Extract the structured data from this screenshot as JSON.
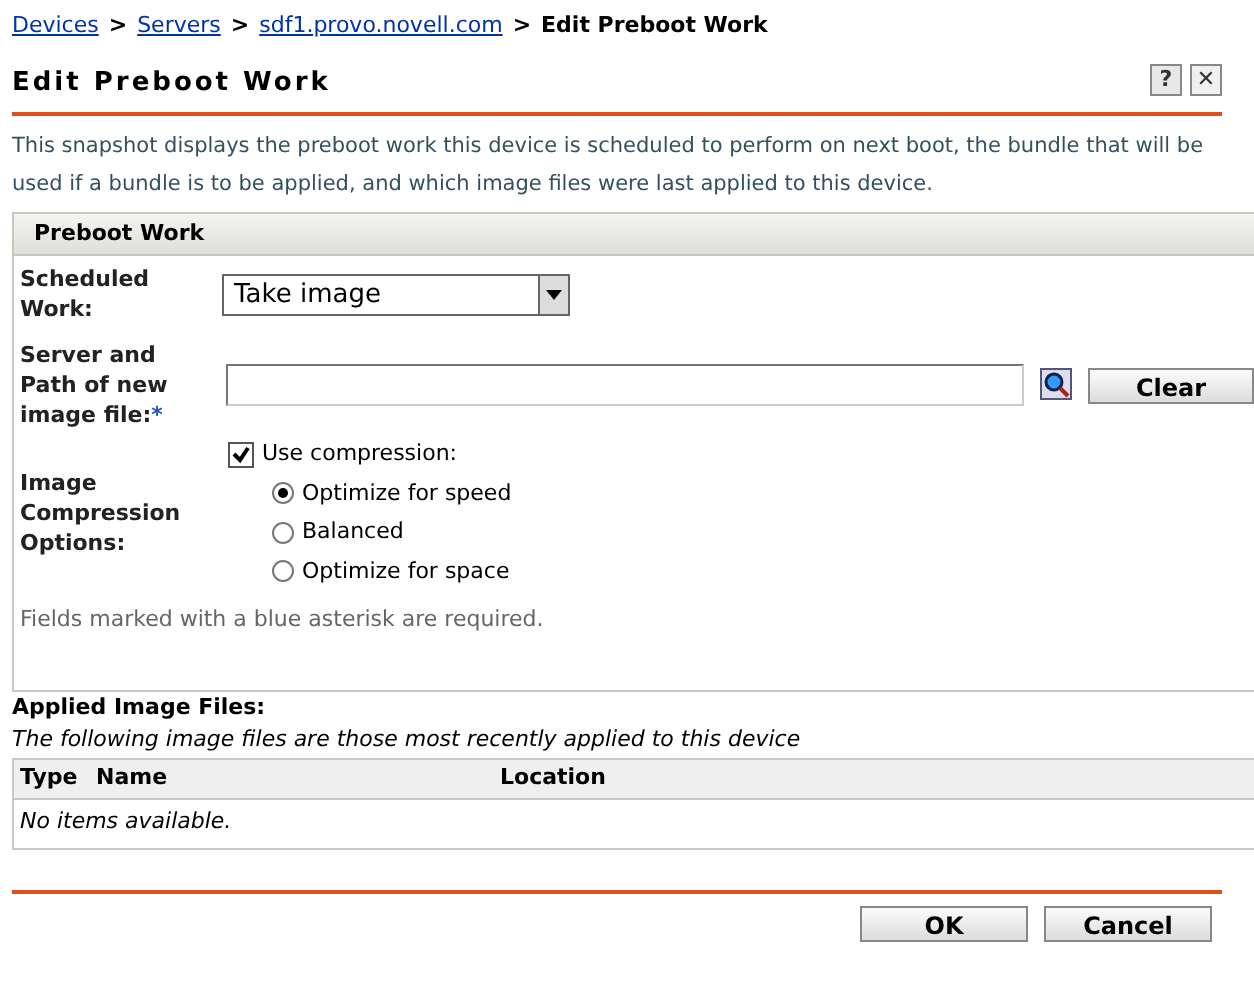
{
  "breadcrumb": [
    {
      "label": "Devices",
      "kind": "link"
    },
    {
      "label": "Servers",
      "kind": "link"
    },
    {
      "label": "sdf1.provo.novell.com",
      "kind": "link"
    },
    {
      "label": "Edit Preboot Work",
      "kind": "current"
    }
  ],
  "breadcrumb_separator": ">",
  "title": "Edit Preboot Work",
  "title_buttons": [
    {
      "label": "?",
      "kind": "help"
    },
    {
      "label": "✕",
      "kind": "close"
    }
  ],
  "description": "This snapshot displays the preboot work this device is scheduled to perform on next boot, the bundle that will be used if a bundle is to be applied, and which image files were last applied to this device.",
  "panel": {
    "title": "Preboot Work",
    "scheduled_work": {
      "label": "Scheduled Work:",
      "value": "Take image"
    },
    "image_path": {
      "label": "Server and Path of new image file:",
      "required_mark": "*",
      "clear_button": "Clear"
    },
    "compression": {
      "label": "Image Compression Options:",
      "checkbox": {
        "label": "Use compression:",
        "checked": true
      },
      "options": [
        {
          "label": "Optimize for speed",
          "selected": true
        },
        {
          "label": "Balanced",
          "selected": false
        },
        {
          "label": "Optimize for space",
          "selected": false
        }
      ]
    },
    "note": "Fields marked with a blue asterisk are required."
  },
  "applied": {
    "title": "Applied Image Files:",
    "subtitle": "The following image files are those most recently applied to this device",
    "columns": [
      "Type",
      "Name",
      "Location"
    ],
    "empty": "No items available."
  },
  "buttons": [
    "OK",
    "Cancel"
  ]
}
